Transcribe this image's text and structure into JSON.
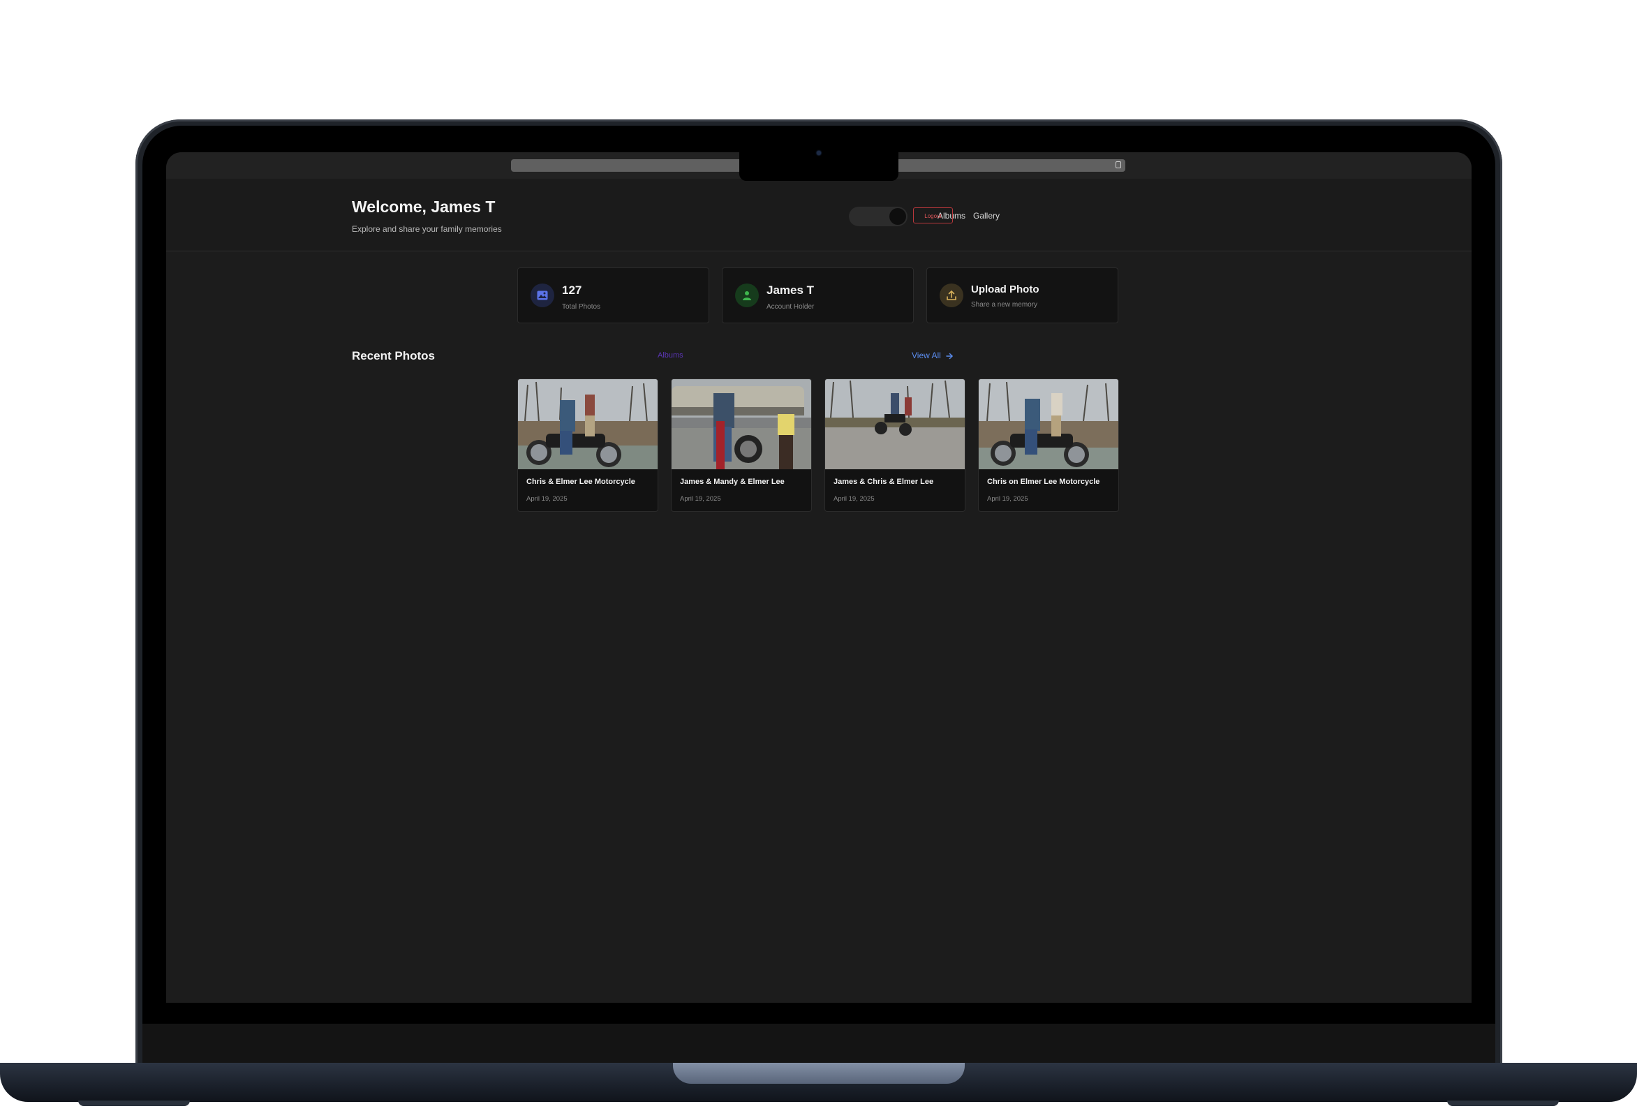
{
  "app": {
    "welcome": "Welcome, James T",
    "subtitle": "Explore and share your family memories",
    "nav": {
      "albums": "Albums",
      "gallery": "Gallery"
    },
    "logout_label": "Logout"
  },
  "stats": [
    {
      "value": "127",
      "label": "Total Photos",
      "icon": "image-icon",
      "color": "#5b73e8"
    },
    {
      "value": "James T",
      "label": "Account Holder",
      "icon": "user-icon",
      "color": "#3fb74e"
    },
    {
      "value": "Upload Photo",
      "label": "Share a new memory",
      "icon": "upload-icon",
      "color": "#d9b25c"
    }
  ],
  "recent": {
    "title": "Recent Photos",
    "albums_link": "Albums",
    "view_all": "View All",
    "photos": [
      {
        "title": "Chris & Elmer Lee Motorcycle",
        "date": "April 19, 2025"
      },
      {
        "title": "James & Mandy & Elmer Lee",
        "date": "April 19, 2025"
      },
      {
        "title": "James & Chris & Elmer Lee",
        "date": "April 19, 2025"
      },
      {
        "title": "Chris on Elmer Lee Motorcycle",
        "date": "April 19, 2025"
      }
    ]
  }
}
